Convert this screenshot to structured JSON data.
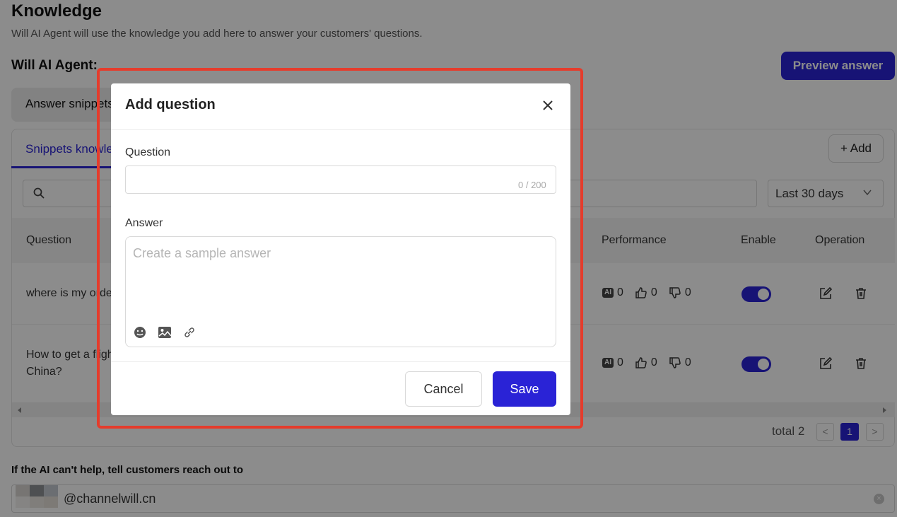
{
  "page": {
    "title": "Knowledge",
    "subtitle": "Will AI Agent will use the knowledge you add here to answer your customers' questions.",
    "agent_label": "Will AI Agent:",
    "preview_button": "Preview answer",
    "segment_active": "Answer snippets",
    "tab_label": "Snippets knowledge",
    "add_button": "+ Add",
    "date_range": "Last 30 days"
  },
  "table": {
    "headers": {
      "question": "Question",
      "performance": "Performance",
      "enable": "Enable",
      "operation": "Operation"
    },
    "rows": [
      {
        "question": "where is my order",
        "ai": "0",
        "up": "0",
        "down": "0",
        "enabled": true
      },
      {
        "question_line1": "How to get a flight to",
        "question_line2": "China?",
        "ai": "0",
        "up": "0",
        "down": "0",
        "enabled": true
      }
    ],
    "ai_badge": "AI"
  },
  "pagination": {
    "total_label": "total 2",
    "current_page": "1",
    "prev": "<",
    "next": ">"
  },
  "fallback": {
    "label": "If the AI can't help, tell customers reach out to",
    "email_suffix": "@channelwill.cn"
  },
  "modal": {
    "title": "Add question",
    "question_label": "Question",
    "question_value": "",
    "question_counter": "0 / 200",
    "answer_label": "Answer",
    "answer_placeholder": "Create a sample answer",
    "cancel_label": "Cancel",
    "save_label": "Save",
    "toolbar_icons": [
      "emoji-icon",
      "image-icon",
      "link-icon"
    ]
  },
  "colors": {
    "accent": "#2a23d6",
    "highlight": "#e53c2c"
  }
}
